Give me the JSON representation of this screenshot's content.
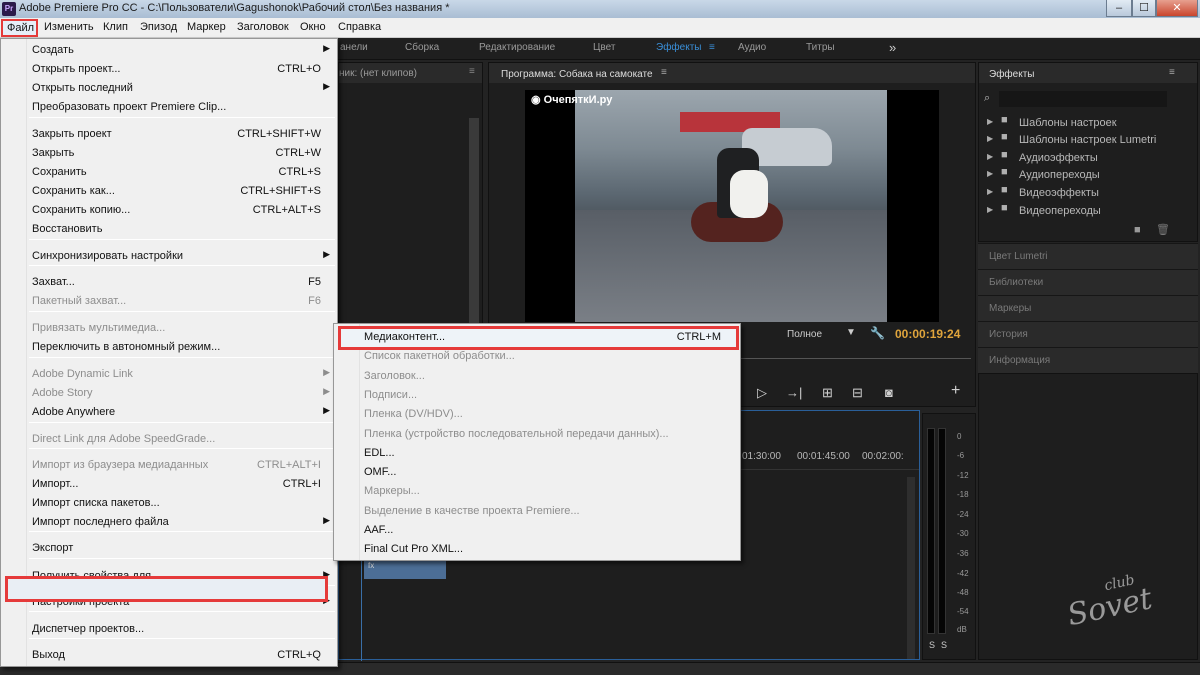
{
  "titlebar": {
    "app_logo": "Pr",
    "title": "Adobe Premiere Pro CC - C:\\Пользователи\\Gagushonok\\Рабочий стол\\Без названия *",
    "min": "–",
    "max": "☐",
    "close": "✕"
  },
  "menubar": [
    "Файл",
    "Изменить",
    "Клип",
    "Эпизод",
    "Маркер",
    "Заголовок",
    "Окно",
    "Справка"
  ],
  "workspaces": [
    "анели",
    "Сборка",
    "Редактирование",
    "Цвет",
    "Эффекты",
    "Аудио",
    "Титры"
  ],
  "workspace_active": "Эффекты",
  "workspace_more": "»",
  "source_panel": {
    "label": "ник: (нет клипов)"
  },
  "program_monitor": {
    "title": "Программа: Собака на самокате",
    "fit": "Полное",
    "timecode": "00:00:19:24",
    "watermark": "ОчепяткИ.ру"
  },
  "timeline": {
    "times": [
      "01:30:00",
      "00:01:45:00",
      "00:02:00:"
    ],
    "fx_badge": "fx"
  },
  "audio_meter": {
    "scale": [
      "0",
      "-6",
      "-12",
      "-18",
      "-24",
      "-30",
      "-36",
      "-42",
      "-48",
      "-54",
      "dB"
    ],
    "solo": [
      "S",
      "S"
    ]
  },
  "effects_panel": {
    "title": "Эффекты",
    "items": [
      "Шаблоны настроек",
      "Шаблоны настроек Lumetri",
      "Аудиоэффекты",
      "Аудиопереходы",
      "Видеоэффекты",
      "Видеопереходы"
    ]
  },
  "right_tabs": [
    "Цвет Lumetri",
    "Библиотеки",
    "Маркеры",
    "История",
    "Информация"
  ],
  "file_menu": {
    "items": [
      {
        "label": "Создать",
        "shortcut": "",
        "submenu": true,
        "disabled": false
      },
      {
        "label": "Открыть проект...",
        "shortcut": "CTRL+O",
        "submenu": false,
        "disabled": false
      },
      {
        "label": "Открыть последний",
        "shortcut": "",
        "submenu": true,
        "disabled": false
      },
      {
        "label": "Преобразовать проект Premiere Clip...",
        "shortcut": "",
        "submenu": false,
        "disabled": false
      },
      {
        "label": "Закрыть проект",
        "shortcut": "CTRL+SHIFT+W",
        "submenu": false,
        "disabled": false
      },
      {
        "label": "Закрыть",
        "shortcut": "CTRL+W",
        "submenu": false,
        "disabled": false
      },
      {
        "label": "Сохранить",
        "shortcut": "CTRL+S",
        "submenu": false,
        "disabled": false
      },
      {
        "label": "Сохранить как...",
        "shortcut": "CTRL+SHIFT+S",
        "submenu": false,
        "disabled": false
      },
      {
        "label": "Сохранить копию...",
        "shortcut": "CTRL+ALT+S",
        "submenu": false,
        "disabled": false
      },
      {
        "label": "Восстановить",
        "shortcut": "",
        "submenu": false,
        "disabled": false
      },
      {
        "label": "Синхронизировать настройки",
        "shortcut": "",
        "submenu": true,
        "disabled": false
      },
      {
        "label": "Захват...",
        "shortcut": "F5",
        "submenu": false,
        "disabled": false
      },
      {
        "label": "Пакетный захват...",
        "shortcut": "F6",
        "submenu": false,
        "disabled": true
      },
      {
        "label": "Привязать мультимедиа...",
        "shortcut": "",
        "submenu": false,
        "disabled": true
      },
      {
        "label": "Переключить в автономный режим...",
        "shortcut": "",
        "submenu": false,
        "disabled": false
      },
      {
        "label": "Adobe Dynamic Link",
        "shortcut": "",
        "submenu": true,
        "disabled": true
      },
      {
        "label": "Adobe Story",
        "shortcut": "",
        "submenu": true,
        "disabled": true
      },
      {
        "label": "Adobe Anywhere",
        "shortcut": "",
        "submenu": true,
        "disabled": false
      },
      {
        "label": "Direct Link для Adobe SpeedGrade...",
        "shortcut": "",
        "submenu": false,
        "disabled": true
      },
      {
        "label": "Импорт из браузера медиаданных",
        "shortcut": "CTRL+ALT+I",
        "submenu": false,
        "disabled": true
      },
      {
        "label": "Импорт...",
        "shortcut": "CTRL+I",
        "submenu": false,
        "disabled": false
      },
      {
        "label": "Импорт списка пакетов...",
        "shortcut": "",
        "submenu": false,
        "disabled": false
      },
      {
        "label": "Импорт последнего файла",
        "shortcut": "",
        "submenu": true,
        "disabled": false
      },
      {
        "label": "Экспорт",
        "shortcut": "",
        "submenu": false,
        "disabled": false
      },
      {
        "label": "Получить свойства для",
        "shortcut": "",
        "submenu": true,
        "disabled": false
      },
      {
        "label": "Настройки проекта",
        "shortcut": "",
        "submenu": true,
        "disabled": false
      },
      {
        "label": "Диспетчер проектов...",
        "shortcut": "",
        "submenu": false,
        "disabled": false
      },
      {
        "label": "Выход",
        "shortcut": "CTRL+Q",
        "submenu": false,
        "disabled": false
      }
    ]
  },
  "export_submenu": {
    "items": [
      {
        "label": "Медиаконтент...",
        "shortcut": "CTRL+M",
        "disabled": false
      },
      {
        "label": "Список пакетной обработки...",
        "shortcut": "",
        "disabled": true
      },
      {
        "label": "Заголовок...",
        "shortcut": "",
        "disabled": true
      },
      {
        "label": "Подписи...",
        "shortcut": "",
        "disabled": true
      },
      {
        "label": "Пленка (DV/HDV)...",
        "shortcut": "",
        "disabled": true
      },
      {
        "label": "Пленка (устройство последовательной передачи данных)...",
        "shortcut": "",
        "disabled": true
      },
      {
        "label": "EDL...",
        "shortcut": "",
        "disabled": false
      },
      {
        "label": "OMF...",
        "shortcut": "",
        "disabled": false
      },
      {
        "label": "Маркеры...",
        "shortcut": "",
        "disabled": true
      },
      {
        "label": "Выделение в качестве проекта Premiere...",
        "shortcut": "",
        "disabled": true
      },
      {
        "label": "AAF...",
        "shortcut": "",
        "disabled": false
      },
      {
        "label": "Final Cut Pro XML...",
        "shortcut": "",
        "disabled": false
      }
    ]
  },
  "corner_watermark": {
    "line1": "club",
    "line2": "Sovet"
  },
  "colors": {
    "highlight_border": "#e53a3a",
    "active_workspace": "#3a8fd8"
  }
}
